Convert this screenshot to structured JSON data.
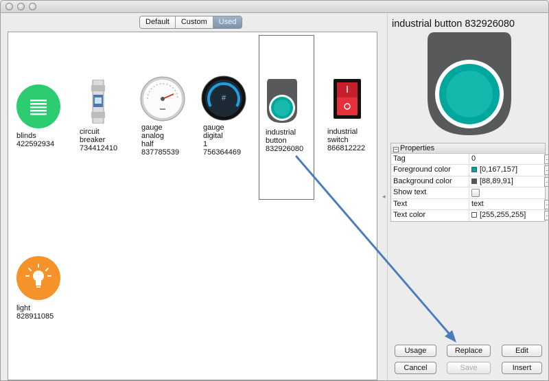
{
  "tabs": {
    "default_label": "Default",
    "custom_label": "Custom",
    "used_label": "Used",
    "selected": "Used"
  },
  "gallery": {
    "items": [
      {
        "label": "blinds\n422592934",
        "icon": "blinds-icon",
        "color": "#2ecc71"
      },
      {
        "label": "circuit\nbreaker\n734412410",
        "icon": "circuit-breaker-icon",
        "color": "#4a78b0"
      },
      {
        "label": "gauge\nanalog\nhalf\n837785539",
        "icon": "gauge-analog-icon",
        "color": "#d33a2c"
      },
      {
        "label": "gauge\ndigital\n1\n756364469",
        "icon": "gauge-digital-icon",
        "color": "#1f9fe0"
      },
      {
        "label": "industrial\nbutton\n832926080",
        "icon": "industrial-button-icon",
        "color": "#00a79d",
        "selected": true
      },
      {
        "label": "industrial\nswitch\n866812222",
        "icon": "industrial-switch-icon",
        "color": "#e8303c"
      },
      {
        "label": "light\n828911085",
        "icon": "light-bulb-icon",
        "color": "#f5922a"
      }
    ]
  },
  "preview": {
    "title": "industrial button 832926080",
    "icon": "industrial-button-preview-icon"
  },
  "properties": {
    "header": "Properties",
    "rows": {
      "tag": {
        "key": "Tag",
        "value": "0"
      },
      "fg": {
        "key": "Foreground color",
        "value": "[0,167,157]",
        "color": "#00a79d"
      },
      "bg": {
        "key": "Background color",
        "value": "[88,89,91]",
        "color": "#58595b"
      },
      "show_text": {
        "key": "Show text",
        "value": false
      },
      "text": {
        "key": "Text",
        "value": "text"
      },
      "text_color": {
        "key": "Text color",
        "value": "[255,255,255]",
        "color": "#ffffff"
      }
    }
  },
  "buttons": {
    "usage": "Usage",
    "replace": "Replace",
    "edit": "Edit",
    "cancel": "Cancel",
    "save": "Save",
    "insert": "Insert"
  },
  "annotation": {
    "color": "#4a7ebb"
  }
}
